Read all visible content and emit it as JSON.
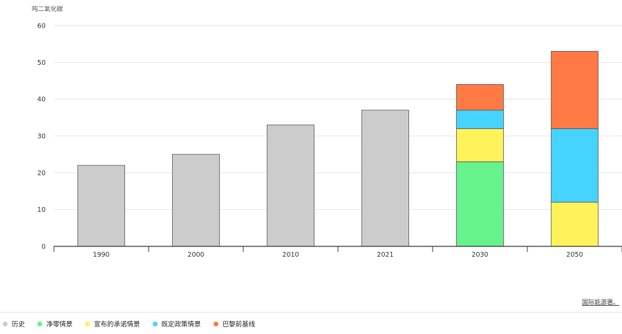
{
  "chart_data": {
    "type": "bar",
    "stacked": true,
    "ylabel": "吨二氧化碳",
    "ylim": [
      0,
      60
    ],
    "yticks": [
      0,
      10,
      20,
      30,
      40,
      50,
      60
    ],
    "categories": [
      "1990",
      "2000",
      "2010",
      "2021",
      "2030",
      "2050"
    ],
    "series": [
      {
        "name": "历史",
        "color": "#cccccc",
        "values": [
          22,
          25,
          33,
          37,
          0,
          0
        ]
      },
      {
        "name": "净零情景",
        "color": "#66f28c",
        "values": [
          0,
          0,
          0,
          0,
          23,
          0
        ]
      },
      {
        "name": "宣布的承诺情景",
        "color": "#fff25a",
        "values": [
          0,
          0,
          0,
          0,
          9,
          12
        ]
      },
      {
        "name": "既定政策情景",
        "color": "#47d3ff",
        "values": [
          0,
          0,
          0,
          0,
          5,
          20
        ]
      },
      {
        "name": "巴黎前基线",
        "color": "#ff7a45",
        "values": [
          0,
          0,
          0,
          0,
          7,
          21
        ]
      }
    ],
    "grid": true,
    "legend_position": "bottom-left"
  },
  "source_label": "国际能源署。"
}
